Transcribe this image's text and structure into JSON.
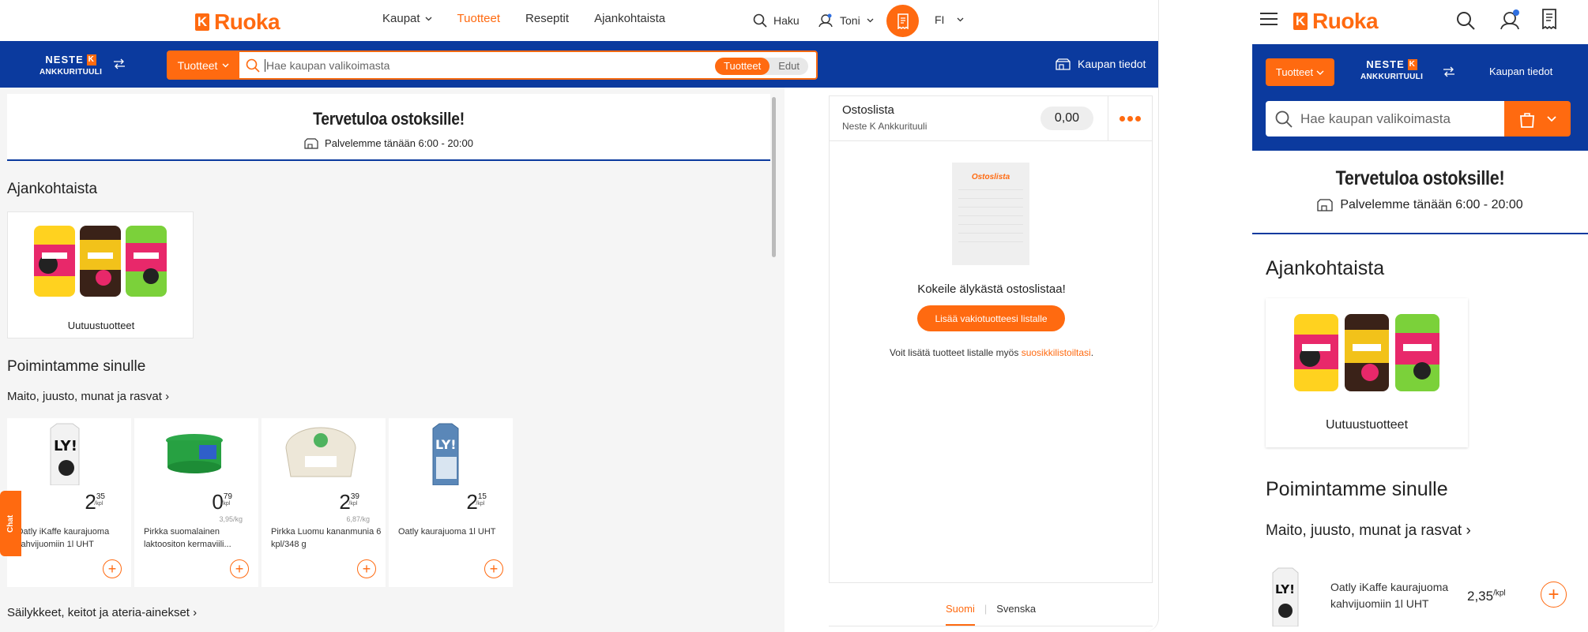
{
  "desktop": {
    "logo": "Ruoka",
    "nav": [
      {
        "label": "Kaupat",
        "dropdown": true
      },
      {
        "label": "Tuotteet",
        "active": true
      },
      {
        "label": "Reseptit"
      },
      {
        "label": "Ajankohtaista"
      }
    ],
    "haku": "Haku",
    "user": "Toni",
    "lang": "FI",
    "store_brand": "NESTE",
    "store_name": "ANKKURITUULI",
    "products_dropdown": "Tuotteet",
    "search_placeholder": "Hae kaupan valikoimasta",
    "search_scope": [
      "Tuotteet",
      "Edut"
    ],
    "store_info": "Kaupan tiedot",
    "welcome_title": "Tervetuloa ostoksille!",
    "hours": "Palvelemme tänään 6:00 - 20:00",
    "news_heading": "Ajankohtaista",
    "news_card": "Uutuustuotteet",
    "picks_heading": "Poimintamme sinulle",
    "category1": "Maito, juusto, munat ja rasvat ›",
    "category2": "Säilykkeet, keitot ja ateria-ainekset ›",
    "products": [
      {
        "euros": "2",
        "cents": "35",
        "unit": "/kpl",
        "per_kg": "",
        "name": "Oatly iKaffe kaurajuoma kahvijuomiin 1l UHT"
      },
      {
        "euros": "0",
        "cents": "79",
        "unit": "/kpl",
        "per_kg": "3,95/kg",
        "name": "Pirkka suomalainen laktoositon kermaviili..."
      },
      {
        "euros": "2",
        "cents": "39",
        "unit": "/kpl",
        "per_kg": "6,87/kg",
        "name": "Pirkka Luomu kananmunia 6 kpl/348 g"
      },
      {
        "euros": "2",
        "cents": "15",
        "unit": "/kpl",
        "per_kg": "",
        "name": "Oatly kaurajuoma 1l UHT"
      }
    ],
    "chat": "Chat",
    "shopping_list": {
      "title": "Ostoslista",
      "store": "Neste K Ankkurituuli",
      "total": "0,00",
      "paper_title": "Ostoslista",
      "prompt": "Kokeile älykästä ostoslistaa!",
      "button": "Lisää vakiotuotteesi listalle",
      "hint_prefix": "Voit lisätä tuotteet listalle myös ",
      "hint_link": "suosikkilistoiltasi",
      "hint_suffix": "."
    },
    "languages": [
      "Suomi",
      "Svenska"
    ]
  },
  "mobile": {
    "logo": "Ruoka",
    "products_dropdown": "Tuotteet",
    "store_brand": "NESTE",
    "store_name": "ANKKURITUULI",
    "store_info": "Kaupan tiedot",
    "search_placeholder": "Hae kaupan valikoimasta",
    "welcome_title": "Tervetuloa ostoksille!",
    "hours": "Palvelemme tänään 6:00 - 20:00",
    "news_heading": "Ajankohtaista",
    "news_card": "Uutuustuotteet",
    "picks_heading": "Poimintamme sinulle",
    "category1": "Maito, juusto, munat ja rasvat ›",
    "product": {
      "name": "Oatly iKaffe kaurajuoma kahvijuomiin 1l UHT",
      "price": "2,35",
      "unit": "/kpl"
    }
  },
  "colors": {
    "accent": "#ff6a10",
    "brand_blue": "#0b3a9e"
  }
}
